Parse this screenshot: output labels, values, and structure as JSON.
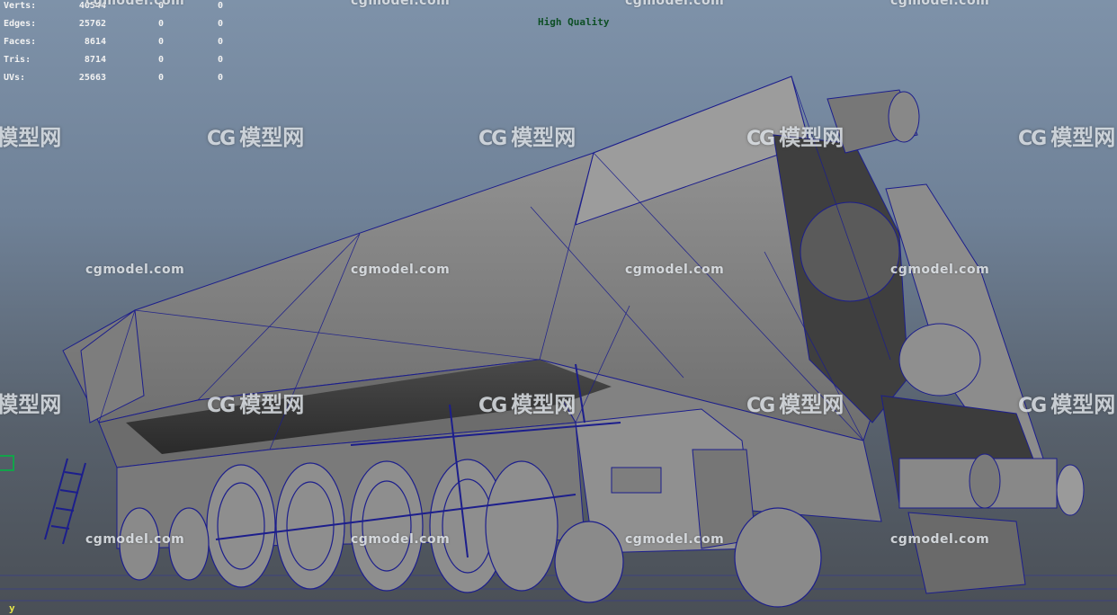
{
  "hud": {
    "rows": [
      {
        "label": "Verts:",
        "v1": "40544",
        "v2": "0",
        "v3": "0"
      },
      {
        "label": "Edges:",
        "v1": "25762",
        "v2": "0",
        "v3": "0"
      },
      {
        "label": "Faces:",
        "v1": "8614",
        "v2": "0",
        "v3": "0"
      },
      {
        "label": "Tris:",
        "v1": "8714",
        "v2": "0",
        "v3": "0"
      },
      {
        "label": "UVs:",
        "v1": "25663",
        "v2": "0",
        "v3": "0"
      }
    ]
  },
  "viewport": {
    "quality_label": "High Quality",
    "axis_label": "y",
    "wireframe_color": "#1c1e8c",
    "shaded_color": "#8a8a8a"
  },
  "watermarks": {
    "site_text": "cgmodel.com",
    "logo_text": "模型网",
    "logo_mark": "CG"
  }
}
